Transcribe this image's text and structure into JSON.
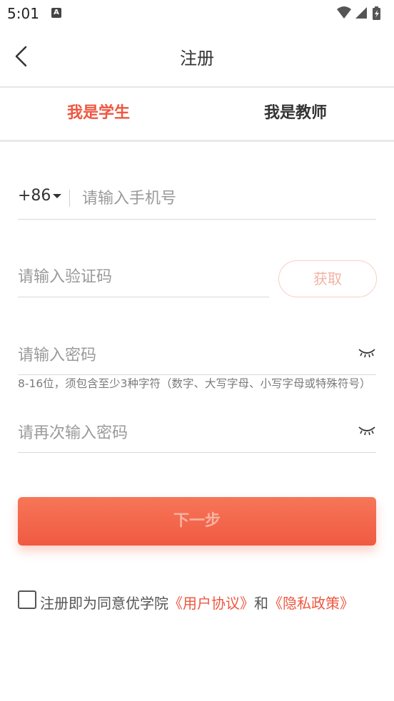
{
  "status": {
    "time": "5:01",
    "notif_icon": "A"
  },
  "header": {
    "title": "注册"
  },
  "tabs": [
    {
      "label": "我是学生",
      "active": true
    },
    {
      "label": "我是教师",
      "active": false
    }
  ],
  "form": {
    "country_code": "+86",
    "phone_placeholder": "请输入手机号",
    "code_placeholder": "请输入验证码",
    "get_code_label": "获取",
    "password_placeholder": "请输入密码",
    "password_hint": "8-16位，须包含至少3种字符（数字、大写字母、小写字母或特殊符号）",
    "confirm_password_placeholder": "请再次输入密码",
    "next_label": "下一步"
  },
  "agreement": {
    "prefix": "注册即为同意优学院",
    "user_agreement": "《用户协议》",
    "and": "和",
    "privacy_policy": "《隐私政策》"
  },
  "colors": {
    "accent": "#ee5740",
    "button_gradient_top": "#f77658",
    "button_gradient_bottom": "#ef5a42"
  }
}
